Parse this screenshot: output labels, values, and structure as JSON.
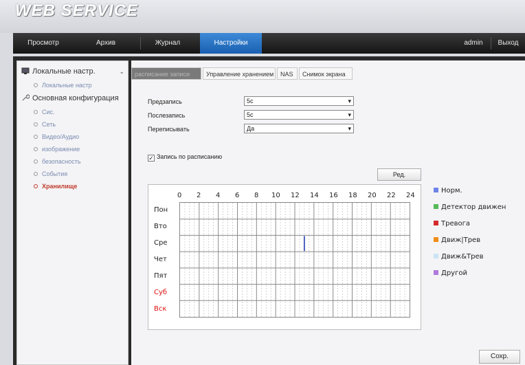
{
  "app": {
    "logo_text": "WEB  SERVICE"
  },
  "navbar": {
    "items": [
      "Просмотр",
      "Архив",
      "Журнал",
      "Настройки"
    ],
    "user": "admin",
    "logout": "Выход"
  },
  "sidebar": {
    "local_settings": "Локальные настр.",
    "local_settings_sub": "Локальные настр",
    "main_config": "Основная конфигурация",
    "items": [
      "Сис.",
      "Сеть",
      "Видео/Аудио",
      "изображение",
      "безопасность",
      "События",
      "Хранилище"
    ]
  },
  "tabs": [
    "расписание записи",
    "Управление хранением",
    "NAS",
    "Снимок экрана"
  ],
  "form": {
    "prerecord_label": "Предзапись",
    "prerecord_value": "5с",
    "postrecord_label": "Послезапись",
    "postrecord_value": "5с",
    "overwrite_label": "Переписывать",
    "overwrite_value": "Да"
  },
  "schedule_checkbox": {
    "label": "Запись по расписанию",
    "checked": true
  },
  "edit_button": "Ред.",
  "hours": [
    "0",
    "2",
    "4",
    "6",
    "8",
    "10",
    "12",
    "14",
    "16",
    "18",
    "20",
    "22",
    "24"
  ],
  "days": [
    "Пон",
    "Вто",
    "Сре",
    "Чет",
    "Пят",
    "Суб",
    "Вск"
  ],
  "legend": [
    {
      "label": "Норм.",
      "color": "#6f82e8"
    },
    {
      "label": "Детектор движен",
      "color": "#58b858"
    },
    {
      "label": "Тревога",
      "color": "#d42a2a"
    },
    {
      "label": "Движ|Трев",
      "color": "#f08c1a"
    },
    {
      "label": "Движ&Трев",
      "color": "#cde3f5"
    },
    {
      "label": "Другой",
      "color": "#b07adc"
    }
  ],
  "save_button": "Сохр."
}
